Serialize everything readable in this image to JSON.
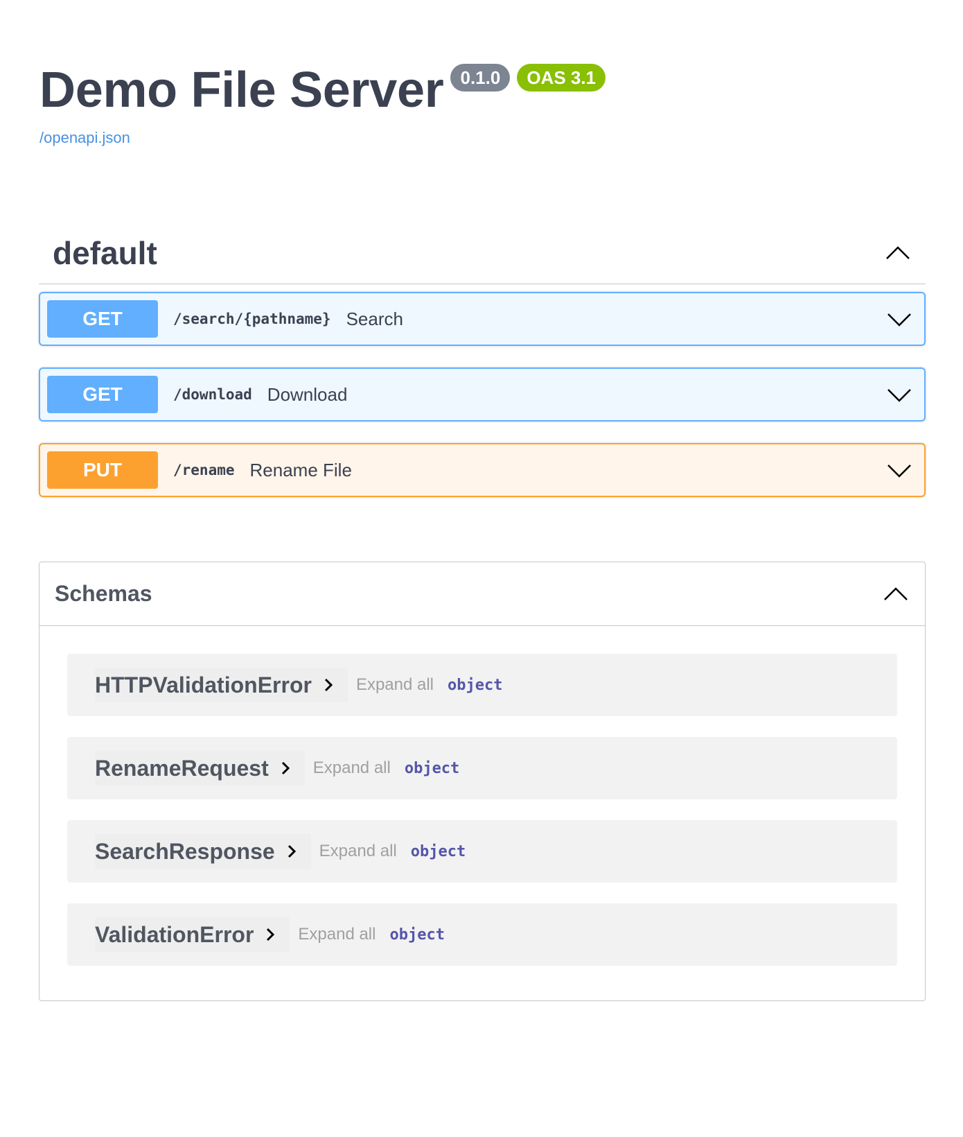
{
  "info": {
    "title": "Demo File Server",
    "version": "0.1.0",
    "oas_version": "OAS 3.1",
    "spec_link": "/openapi.json"
  },
  "tag": {
    "name": "default",
    "collapse_icon": "chevron-up-icon"
  },
  "operations": [
    {
      "method": "GET",
      "path": "/search/{pathname}",
      "summary": "Search",
      "color": "#61affe"
    },
    {
      "method": "GET",
      "path": "/download",
      "summary": "Download",
      "color": "#61affe"
    },
    {
      "method": "PUT",
      "path": "/rename",
      "summary": "Rename File",
      "color": "#fca130"
    }
  ],
  "schemas": {
    "title": "Schemas",
    "collapse_icon": "chevron-up-icon",
    "items": [
      {
        "name": "HTTPValidationError",
        "expand_label": "Expand all",
        "type": "object"
      },
      {
        "name": "RenameRequest",
        "expand_label": "Expand all",
        "type": "object"
      },
      {
        "name": "SearchResponse",
        "expand_label": "Expand all",
        "type": "object"
      },
      {
        "name": "ValidationError",
        "expand_label": "Expand all",
        "type": "object"
      }
    ]
  },
  "colors": {
    "get": "#61affe",
    "put": "#fca130",
    "version_badge": "#7d8492",
    "oas_badge": "#89bf04",
    "link": "#4990e2",
    "text": "#3b4151"
  }
}
